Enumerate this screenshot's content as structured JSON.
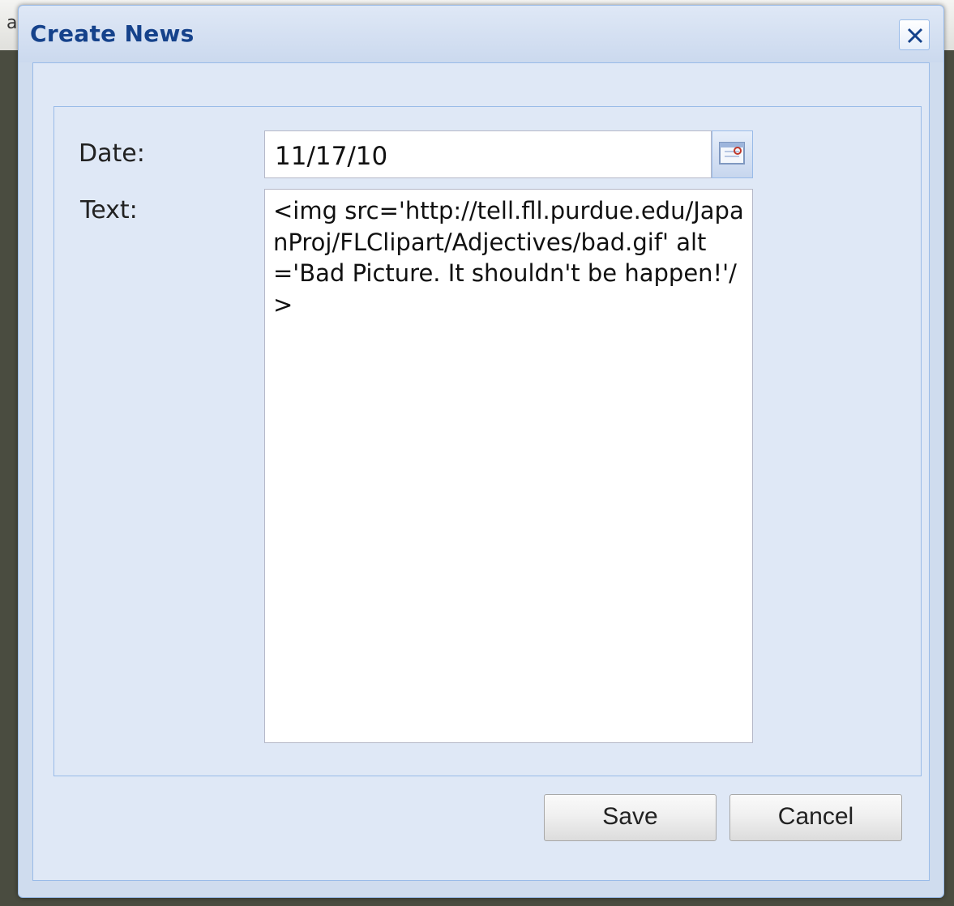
{
  "backdrop": {
    "edge_char": "a"
  },
  "dialog": {
    "title": "Create News",
    "close_icon": "close-icon"
  },
  "form": {
    "date_label": "Date:",
    "date_value": "11/17/10",
    "date_trigger_icon": "calendar-icon",
    "text_label": "Text:",
    "text_value": "<img src='http://tell.fll.purdue.edu/JapanProj/FLClipart/Adjectives/bad.gif' alt='Bad Picture. It shouldn't be happen!'/>"
  },
  "buttons": {
    "save_label": "Save",
    "cancel_label": "Cancel"
  },
  "colors": {
    "title_text": "#15428b",
    "panel_border": "#99bbe8",
    "panel_bg": "#dfe8f6",
    "backdrop": "#4a4c40"
  }
}
